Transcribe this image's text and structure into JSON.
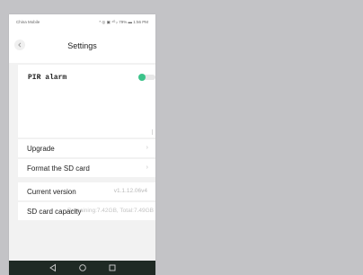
{
  "status_bar": {
    "carrier": "China Mobile",
    "indicators": "* ◎ ▣ ⁴ᴳ ᵢₗ 79% ▬ 1:56 PM"
  },
  "header": {
    "title": "Settings",
    "back_icon": "chevron-left-icon"
  },
  "pir": {
    "label": "PIR alarm",
    "enabled": true,
    "accent_color": "#3cc38a"
  },
  "menu": {
    "upgrade_label": "Upgrade",
    "format_label": "Format the SD card",
    "chevron": "›"
  },
  "info": {
    "version_label": "Current version",
    "version_value": "v1.1.12.06v4",
    "capacity_label": "SD card capacity",
    "capacity_value": "Remaining:7.42GB, Total:7.49GB"
  },
  "bottom_nav": {
    "back_icon": "triangle-back-icon",
    "home_icon": "circle-home-icon",
    "recents_icon": "square-recents-icon"
  }
}
